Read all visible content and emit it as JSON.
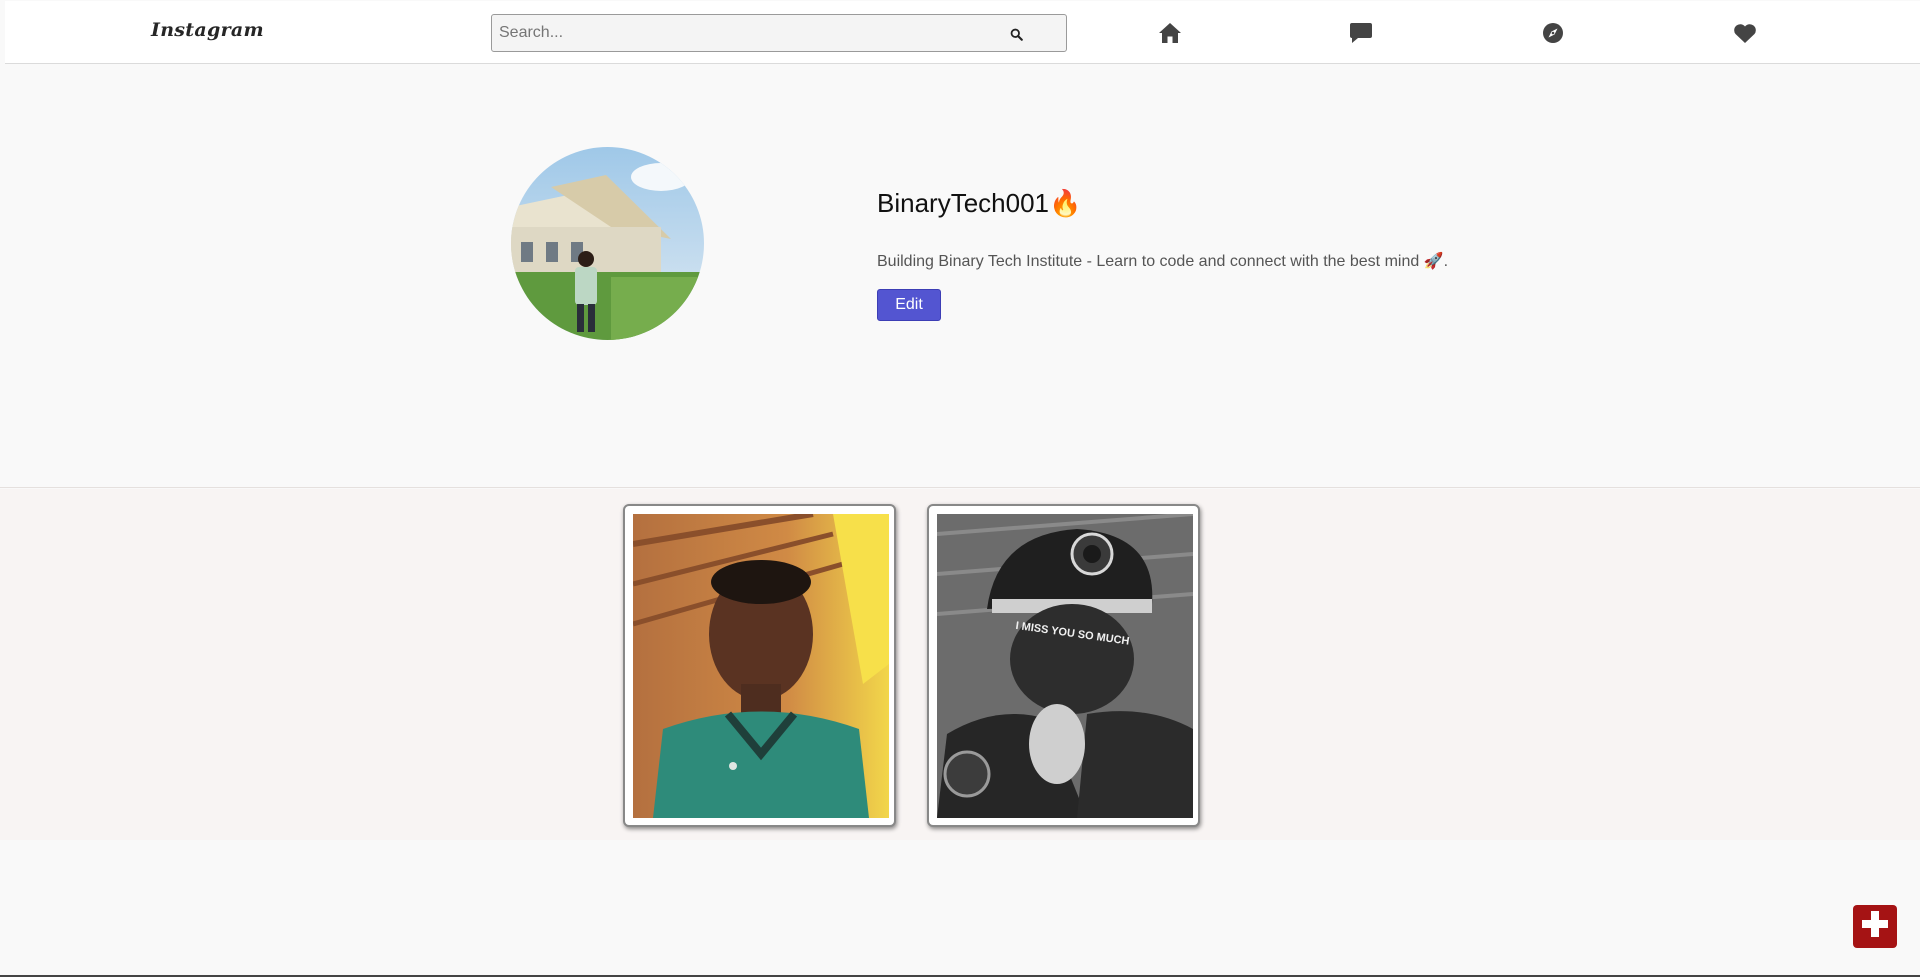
{
  "header": {
    "logo": "Instagram",
    "search_placeholder": "Search...",
    "icons": [
      "search-icon",
      "home-icon",
      "message-icon",
      "compass-icon",
      "heart-icon"
    ]
  },
  "profile": {
    "username": "BinaryTech001🔥",
    "bio": "Building Binary Tech Institute - Learn to code and connect with the best mind 🚀.",
    "edit_label": "Edit"
  },
  "posts": [
    {
      "id_label": "post-1"
    },
    {
      "id_label": "post-2",
      "overlay_text": "I MISS YOU SO MUCH"
    }
  ],
  "colors": {
    "accent": "#5355d1",
    "fab": "#a51314",
    "icon": "#444444"
  },
  "fab_icon": "plus-icon"
}
